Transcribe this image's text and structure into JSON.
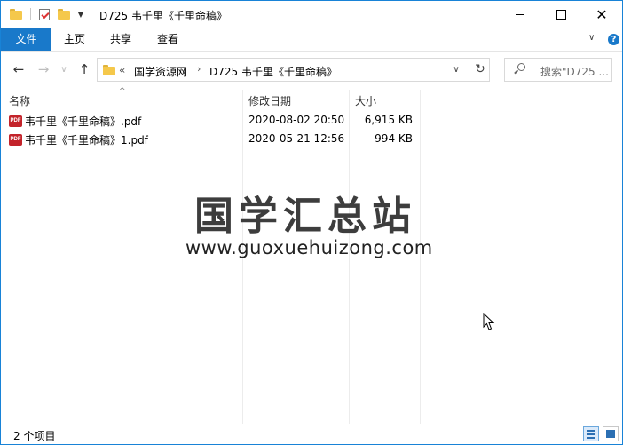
{
  "window": {
    "title": "D725 韦千里《千里命稿》",
    "controls": {
      "minimize": "─",
      "maximize": "□",
      "close": "✕"
    }
  },
  "ribbon": {
    "tabs": [
      {
        "label": "文件",
        "active": true
      },
      {
        "label": "主页",
        "active": false
      },
      {
        "label": "共享",
        "active": false
      },
      {
        "label": "查看",
        "active": false
      }
    ],
    "expand_glyph": "∨",
    "help_glyph": "?"
  },
  "nav": {
    "back": "←",
    "forward": "→",
    "recent": "∨",
    "up": "↑",
    "overflow": "«",
    "breadcrumbs": [
      "国学资源网",
      "D725 韦千里《千里命稿》"
    ],
    "crumb_sep": "›",
    "dropdown": "∨",
    "refresh": "↻"
  },
  "search": {
    "placeholder": "搜索\"D725 ..."
  },
  "columns": {
    "name": "名称",
    "date": "修改日期",
    "size": "大小",
    "sort_glyph": "^"
  },
  "files": [
    {
      "icon": "PDF",
      "name": "韦千里《千里命稿》.pdf",
      "date": "2020-08-02 20:50",
      "size": "6,915 KB"
    },
    {
      "icon": "PDF",
      "name": "韦千里《千里命稿》1.pdf",
      "date": "2020-05-21 12:56",
      "size": "994 KB"
    }
  ],
  "watermark": {
    "cn": "国学汇总站",
    "en": "www.guoxuehuizong.com"
  },
  "status": {
    "count": "2 个项目"
  },
  "colors": {
    "accent": "#1979ca",
    "pdf_red": "#c3232a",
    "folder": "#f5c84b"
  }
}
